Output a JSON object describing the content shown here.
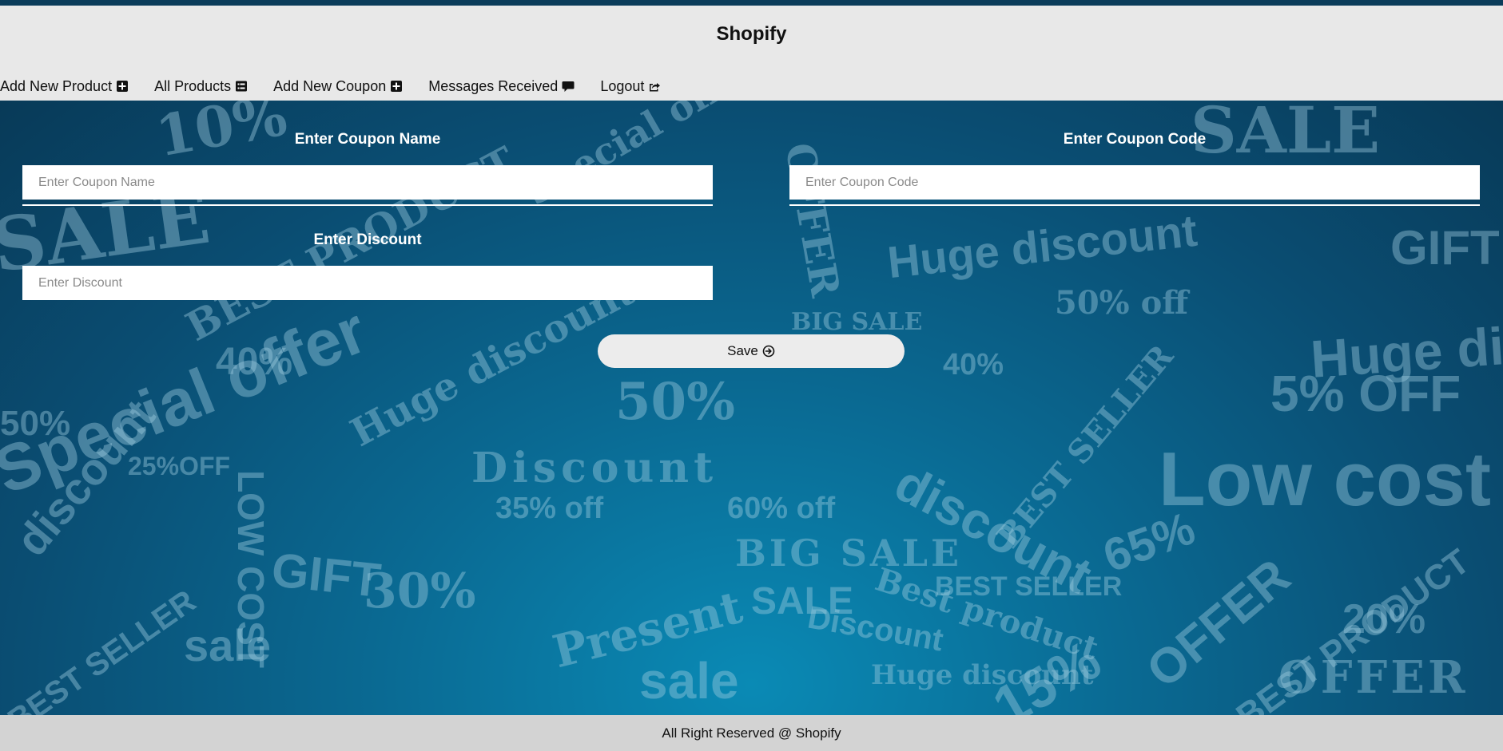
{
  "header": {
    "brand": "Shopify"
  },
  "nav": {
    "items": [
      {
        "label": "Add New Product",
        "icon": "plus-square-icon"
      },
      {
        "label": "All Products",
        "icon": "list-icon"
      },
      {
        "label": "Add New Coupon",
        "icon": "plus-square-icon"
      },
      {
        "label": "Messages Received",
        "icon": "comment-icon"
      },
      {
        "label": "Logout",
        "icon": "share-out-icon"
      }
    ]
  },
  "form": {
    "coupon_name": {
      "label": "Enter Coupon Name",
      "placeholder": "Enter Coupon Name",
      "value": ""
    },
    "coupon_code": {
      "label": "Enter Coupon Code",
      "placeholder": "Enter Coupon Code",
      "value": ""
    },
    "discount": {
      "label": "Enter Discount",
      "placeholder": "Enter Discount",
      "value": ""
    },
    "save_label": "Save",
    "save_icon": "arrow-circle-right-icon"
  },
  "background": {
    "words": [
      "SALE",
      "10%",
      "Special offer",
      "OFFER",
      "Huge discount",
      "SALE",
      "GIFT",
      "Huge discount",
      "BEST PRODUCT",
      "Special offer",
      "40%",
      "50%",
      "discount",
      "25%OFF",
      "LOW COST",
      "GIFT",
      "30%",
      "sale",
      "BEST SELLER",
      "Huge discount",
      "Discount",
      "35% off",
      "50%",
      "60% off",
      "BIG SALE",
      "Present",
      "sale",
      "SALE",
      "Discount",
      "Huge discount",
      "Best product",
      "BEST SELLER",
      "discount",
      "65%",
      "Low cost",
      "5% OFF",
      "OFFER",
      "BEST PRODUCT",
      "20%",
      "OFFER",
      "15%",
      "BIG SALE",
      "40%",
      "BEST SELLER",
      "50% off"
    ]
  },
  "footer": {
    "text": "All Right Reserved @ Shopify"
  },
  "colors": {
    "header_bg": "#e8e8e8",
    "footer_bg": "#d3d3d3",
    "hero_bg": "#0a5a82",
    "label_color": "#ffffff"
  }
}
